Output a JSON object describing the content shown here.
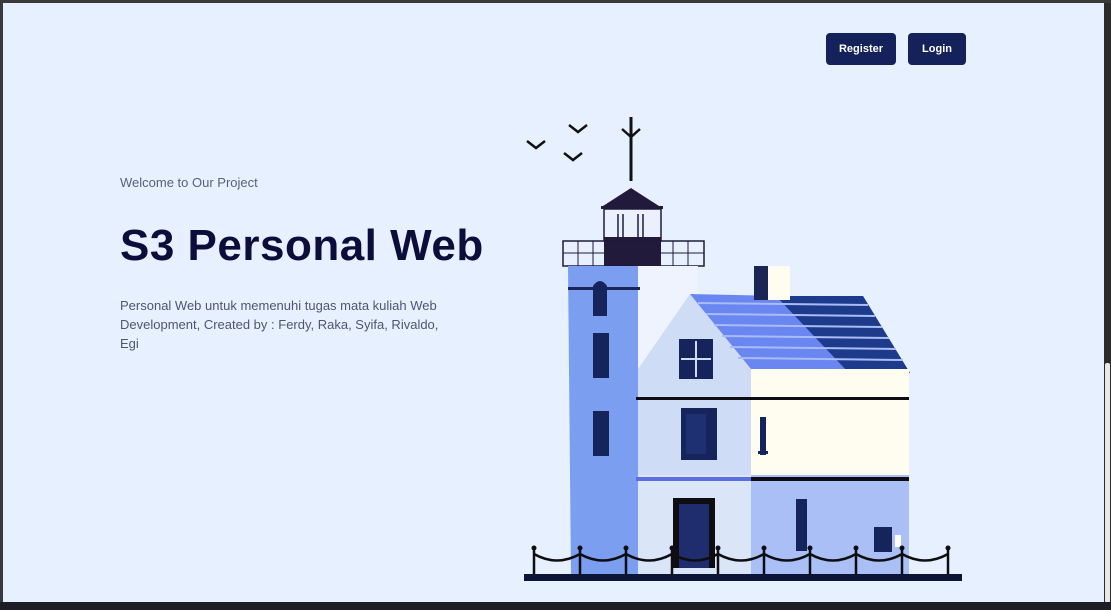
{
  "header": {
    "register_label": "Register",
    "login_label": "Login"
  },
  "hero": {
    "welcome": "Welcome to Our Project",
    "title": "S3 Personal Web",
    "description": "Personal Web untuk memenuhi tugas mata kuliah Web Development, Created by : Ferdy, Raka, Syifa, Rivaldo, Egi"
  },
  "illustration": {
    "name": "lighthouse-illustration"
  },
  "colors": {
    "background": "#e7f0fe",
    "button": "#14215a",
    "title": "#0b0e3a",
    "tower": "#7b9ef0",
    "roof": "#6a86f0",
    "wall_cream": "#fffdf0"
  }
}
